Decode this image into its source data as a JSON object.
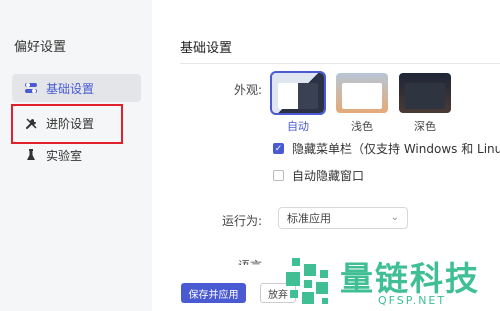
{
  "sidebar": {
    "title": "偏好设置",
    "items": [
      {
        "label": "基础设置",
        "icon": "toggle-icon"
      },
      {
        "label": "进阶设置",
        "icon": "tools-icon"
      },
      {
        "label": "实验室",
        "icon": "flask-icon"
      }
    ]
  },
  "main": {
    "section_title": "基础设置",
    "appearance_label": "外观:",
    "themes": [
      {
        "label": "自动",
        "selected": true
      },
      {
        "label": "浅色",
        "selected": false
      },
      {
        "label": "深色",
        "selected": false
      }
    ],
    "checkboxes": [
      {
        "label": "隐藏菜单栏（仅支持 Windows 和 Linux）",
        "checked": true
      },
      {
        "label": "自动隐藏窗口",
        "checked": false
      }
    ],
    "run_as_label": "运行为:",
    "run_as_value": "标准应用",
    "partial_label": "语言",
    "save_button": "保存并应用",
    "secondary_button": "放弃"
  },
  "watermark": {
    "text": "量链科技",
    "sub": "QFSP.NET"
  },
  "colors": {
    "accent": "#4a5ad2",
    "highlight": "#e0202a",
    "watermark": "#3fbf93"
  }
}
